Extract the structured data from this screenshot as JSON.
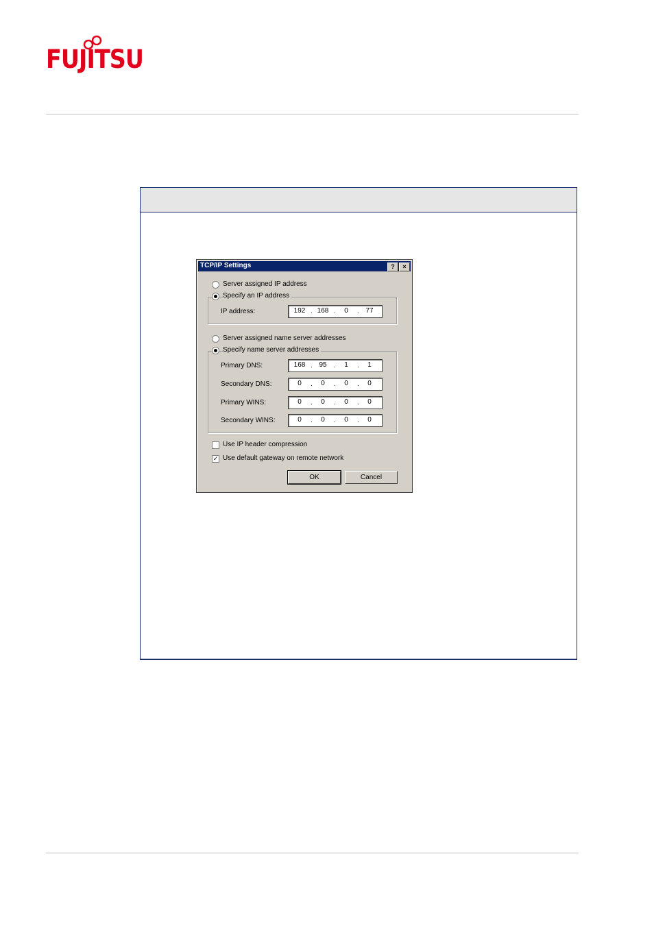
{
  "logo": {
    "text": "FUJITSU",
    "color": "#e2001a"
  },
  "dialog": {
    "title": "TCP/IP Settings",
    "help_button": "?",
    "close_button": "×",
    "ip_options": {
      "server_assigned": "Server assigned IP address",
      "specify": "Specify an IP address",
      "selected": "specify"
    },
    "ip_address": {
      "label": "IP address:",
      "octets": [
        "192",
        "168",
        "0",
        "77"
      ]
    },
    "dns_options": {
      "server_assigned": "Server assigned name server addresses",
      "specify": "Specify name server addresses",
      "selected": "specify"
    },
    "primary_dns": {
      "label": "Primary DNS:",
      "octets": [
        "168",
        "95",
        "1",
        "1"
      ]
    },
    "secondary_dns": {
      "label": "Secondary DNS:",
      "octets": [
        "0",
        "0",
        "0",
        "0"
      ]
    },
    "primary_wins": {
      "label": "Primary WINS:",
      "octets": [
        "0",
        "0",
        "0",
        "0"
      ]
    },
    "secondary_wins": {
      "label": "Secondary WINS:",
      "octets": [
        "0",
        "0",
        "0",
        "0"
      ]
    },
    "header_compression": {
      "label": "Use IP header compression",
      "checked": false
    },
    "default_gateway": {
      "label": "Use default gateway on remote network",
      "checked": true
    },
    "ok_label": "OK",
    "cancel_label": "Cancel"
  }
}
